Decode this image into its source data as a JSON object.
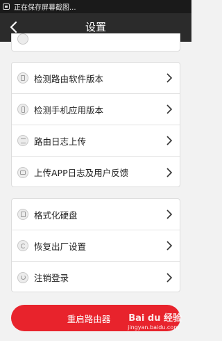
{
  "status_bar": {
    "text": "正在保存屏幕截图..."
  },
  "header": {
    "title": "设置"
  },
  "top_row": {
    "label": ""
  },
  "group1": [
    {
      "label": "检测路由软件版本",
      "icon": "router-firmware-icon"
    },
    {
      "label": "检测手机应用版本",
      "icon": "phone-app-icon"
    },
    {
      "label": "路由日志上传",
      "icon": "log-upload-icon"
    },
    {
      "label": "上传APP日志及用户反馈",
      "icon": "feedback-icon"
    }
  ],
  "group2": [
    {
      "label": "格式化硬盘",
      "icon": "disk-icon"
    },
    {
      "label": "恢复出厂设置",
      "icon": "factory-reset-icon"
    },
    {
      "label": "注销登录",
      "icon": "power-icon"
    }
  ],
  "reboot_button": {
    "label": "重启路由器"
  },
  "watermark": {
    "brand": "Bai du 经验",
    "url": "jingyan.baidu.com"
  },
  "colors": {
    "accent": "#e8232c",
    "navbar": "#2b2b2b"
  }
}
